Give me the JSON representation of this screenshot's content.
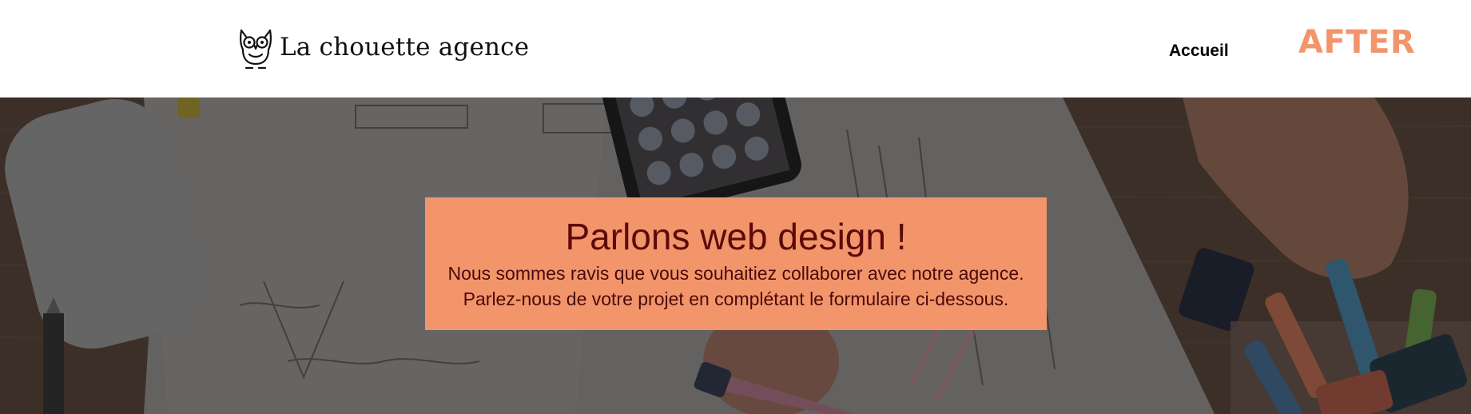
{
  "header": {
    "logo_icon": "owl-icon",
    "brand": "La chouette agence",
    "nav": {
      "home_label": "Accueil"
    },
    "after_label": "AFTER"
  },
  "hero": {
    "background": "overhead photo of a desk with sketches, smartphone, mouse and markers (darkened)",
    "title": "Parlons web design !",
    "lines": [
      "Nous sommes ravis que vous souhaitiez collaborer avec notre agence.",
      "Parlez-nous de votre projet en complétant le formulaire ci-dessous."
    ]
  },
  "colors": {
    "accent": "#f2956a",
    "title_text": "#5c0a0a",
    "header_bg": "#ffffff"
  }
}
